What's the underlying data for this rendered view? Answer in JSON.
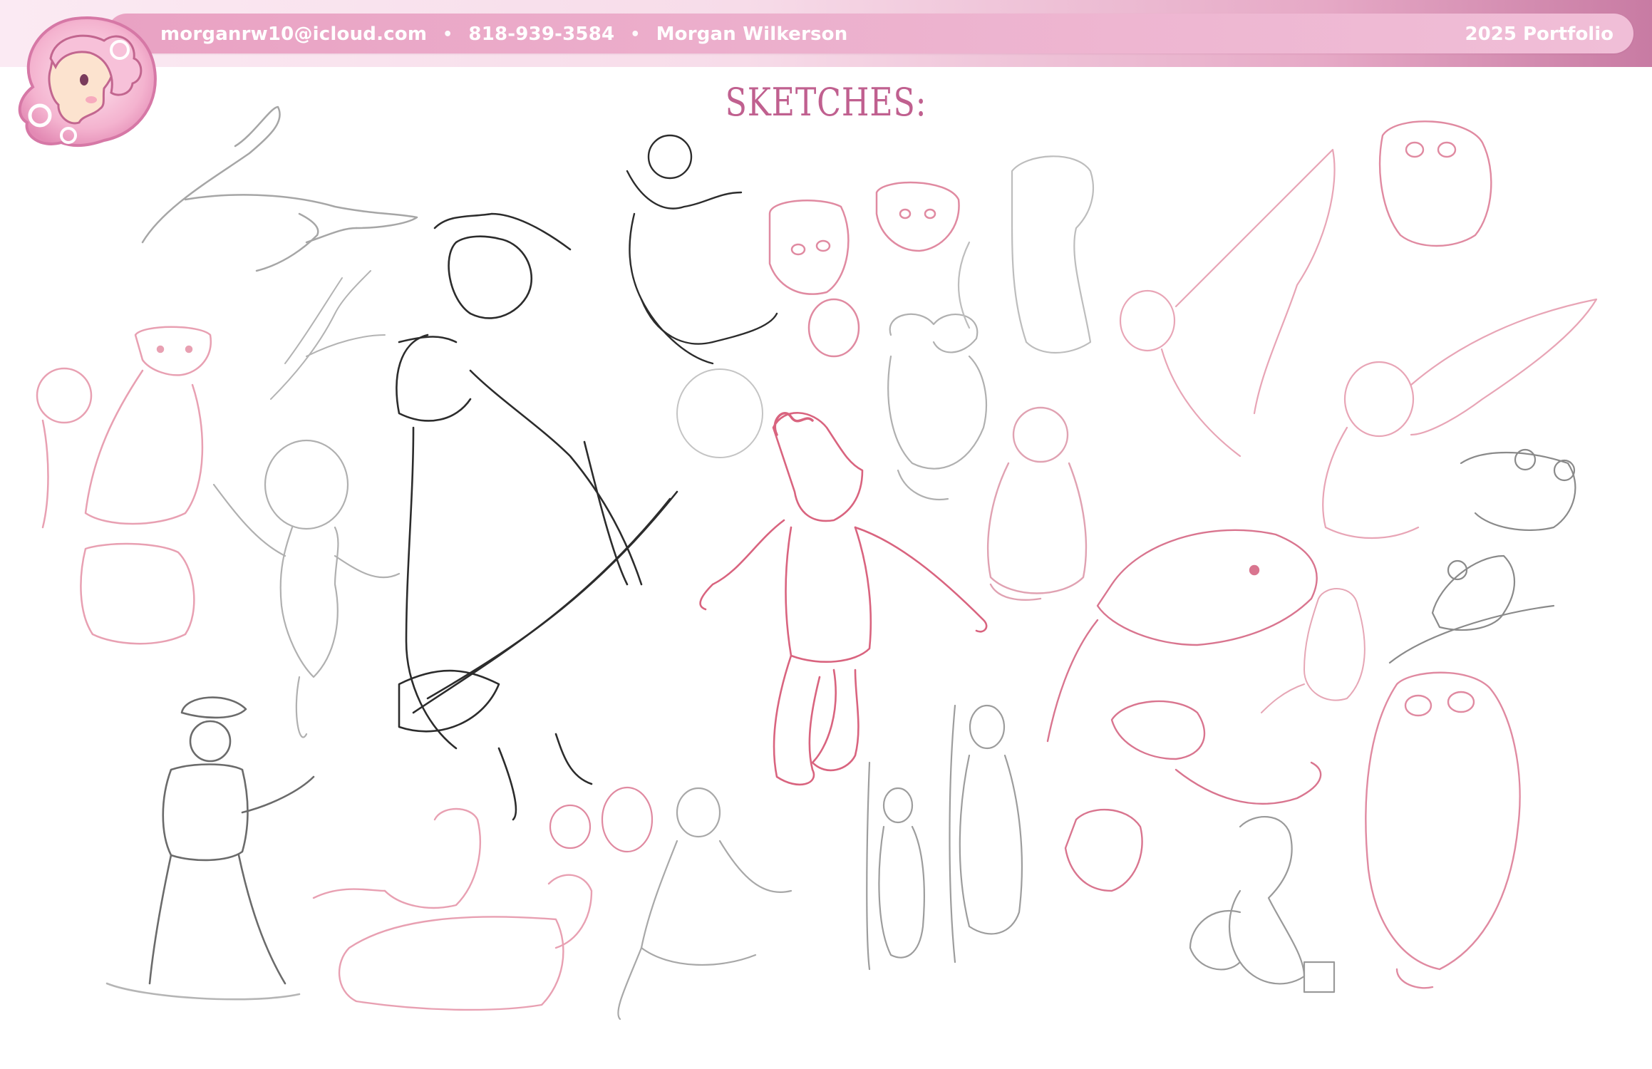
{
  "header": {
    "email": "morganrw10@icloud.com",
    "phone": "818-939-3584",
    "name": "Morgan Wilkerson",
    "separator": "•",
    "portfolio_label": "2025 Portfolio"
  },
  "logo": {
    "icon": "girl-profile-logo-icon"
  },
  "page": {
    "title": "SKETCHES:"
  },
  "colors": {
    "accent_pink": "#c0608f",
    "pill": "#eeb1cd",
    "sketch_pink": "#e6889f",
    "sketch_grey": "#9a9a9a",
    "sketch_black": "#2a2a2a"
  }
}
